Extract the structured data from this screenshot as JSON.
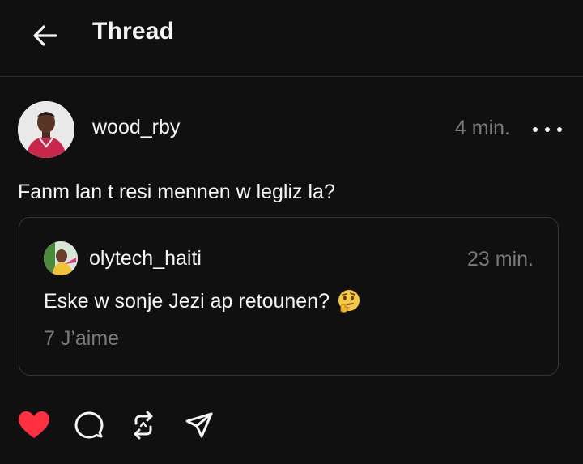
{
  "header": {
    "title": "Thread",
    "back_icon": "arrow-left-icon"
  },
  "post": {
    "username": "wood_rby",
    "time": "4 min.",
    "text": "Fanm lan t resi mennen w legliz la?",
    "more_icon": "more-horizontal-icon"
  },
  "quoted_post": {
    "username": "olytech_haiti",
    "time": "23 min.",
    "text": "Eske w sonje Jezi ap retounen?",
    "emoji": "thinking-face",
    "likes": "7 J’aime"
  },
  "actions": {
    "like_icon": "heart-icon",
    "comment_icon": "comment-icon",
    "repost_icon": "repost-icon",
    "share_icon": "send-icon",
    "like_color": "#ff3040"
  }
}
